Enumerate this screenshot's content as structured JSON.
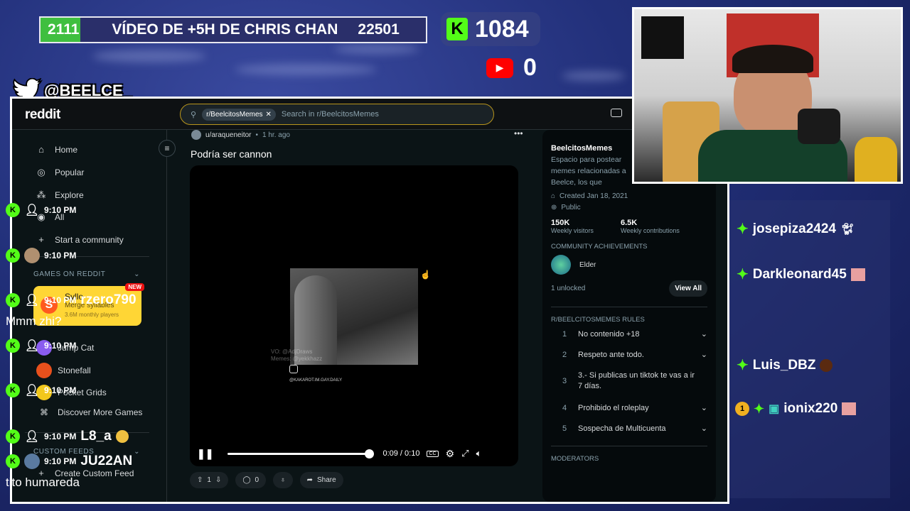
{
  "overlay": {
    "goal_current": "2111",
    "goal_title": "VÍDEO DE +5H DE CHRIS CHAN",
    "goal_target": "22501",
    "goal_progress": 0.094,
    "kick_count": "1084",
    "youtube_count": "0",
    "twitter_handle": "@BEELCE_",
    "kick_letter": "K"
  },
  "reddit": {
    "logo": "reddit",
    "search": {
      "chip": "r/BeelcitosMemes",
      "placeholder": "Search in r/BeelcitosMemes"
    },
    "nav": [
      {
        "label": "Home",
        "icon": "home-icon"
      },
      {
        "label": "Popular",
        "icon": "popular-icon"
      },
      {
        "label": "Explore",
        "icon": "explore-icon"
      },
      {
        "label": "All",
        "icon": "all-icon"
      },
      {
        "label": "Start a community",
        "icon": "plus-icon"
      }
    ],
    "games_header": "GAMES ON REDDIT",
    "featured_game": {
      "badge": "NEW",
      "name": "Syllo",
      "tagline": "Merge syllables",
      "players": "3.6M monthly players"
    },
    "games": [
      {
        "label": "Jump Cat"
      },
      {
        "label": "Stonefall"
      },
      {
        "label": "Pocket Grids"
      },
      {
        "label": "Discover More Games"
      }
    ],
    "custom_feeds_header": "CUSTOM FEEDS",
    "create_feed": "Create Custom Feed",
    "post": {
      "author": "u/araqueneitor",
      "time": "1 hr. ago",
      "title": "Podría ser cannon",
      "watermark_vo": "VO: @AdjDraws",
      "watermark_memes": "Memes: @yekkhazz",
      "watermark_account": "@KAKAROT.IM.GAY.DAILY",
      "time_display": "0:09 / 0:10",
      "progress": 0.9,
      "votes": "1",
      "comments": "0",
      "share": "Share"
    },
    "community": {
      "name": "BeelcitosMemes",
      "description": "Espacio para postear memes relacionadas a Beelce, los que podrían salir en Stream!",
      "created": "Created Jan 18, 2021",
      "visibility": "Public",
      "visitors": "150K",
      "visitors_label": "Weekly visitors",
      "contributions": "6.5K",
      "contributions_label": "Weekly contributions",
      "achievements_header": "COMMUNITY ACHIEVEMENTS",
      "achievement": "Elder",
      "unlocked": "1 unlocked",
      "view_all": "View All",
      "rules_header": "R/BEELCITOSMEMES RULES",
      "rules": [
        {
          "n": "1",
          "text": "No contenido +18"
        },
        {
          "n": "2",
          "text": "Respeto ante todo."
        },
        {
          "n": "3",
          "text": "3.- Si publicas un tiktok te vas a ir 7 días."
        },
        {
          "n": "4",
          "text": "Prohibido el roleplay"
        },
        {
          "n": "5",
          "text": "Sospecha de Multicuenta"
        }
      ],
      "moderators_header": "MODERATORS"
    }
  },
  "chat": [
    {
      "time": "9:10 PM",
      "user": "josepiza2424",
      "message": ""
    },
    {
      "time": "9:10 PM",
      "user": "Darkleonard45",
      "message": ""
    },
    {
      "time": "9:10 PM",
      "user": "rzero790",
      "message": "Mmm zhi?"
    },
    {
      "time": "9:10 PM",
      "user": "Luis_DBZ",
      "message": ""
    },
    {
      "time": "9:10 PM",
      "user": "ionix220",
      "message": ""
    },
    {
      "time": "9:10 PM",
      "user": "L8_a",
      "message": ""
    },
    {
      "time": "9:10 PM",
      "user": "JU22AN",
      "message": "tito humareda"
    }
  ]
}
